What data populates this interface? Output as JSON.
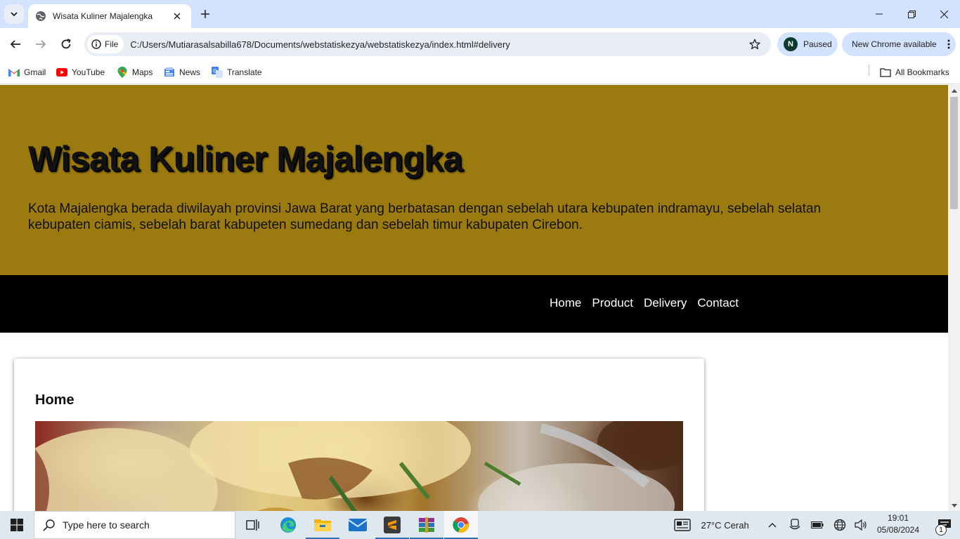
{
  "browser": {
    "tab": {
      "title": "Wisata Kuliner Majalengka"
    },
    "address": {
      "scheme_label": "File",
      "url": "C:/Users/Mutiarasalsabilla678/Documents/webstatiskezya/webstatiskezya/index.html#delivery"
    },
    "profile": {
      "initial": "N",
      "status": "Paused"
    },
    "update_label": "New Chrome available",
    "bookmarks": [
      {
        "label": "Gmail",
        "icon": "gmail-icon"
      },
      {
        "label": "YouTube",
        "icon": "youtube-icon"
      },
      {
        "label": "Maps",
        "icon": "maps-icon"
      },
      {
        "label": "News",
        "icon": "news-icon"
      },
      {
        "label": "Translate",
        "icon": "translate-icon"
      }
    ],
    "all_bookmarks_label": "All Bookmarks"
  },
  "page": {
    "header": {
      "title": "Wisata Kuliner Majalengka",
      "description": "Kota Majalengka berada diwilayah provinsi Jawa Barat yang berbatasan dengan sebelah utara kebupaten indramayu, sebelah selatan kebupaten ciamis, sebelah barat kabupeten sumedang dan sebelah timur kabupaten Cirebon."
    },
    "nav": [
      "Home",
      "Product",
      "Delivery",
      "Contact"
    ],
    "section": {
      "heading": "Home"
    },
    "colors": {
      "header_bg": "#9b7b0f",
      "nav_bg": "#000000"
    }
  },
  "taskbar": {
    "search_placeholder": "Type here to search",
    "weather": {
      "temp": "27°C",
      "condition": "Cerah"
    },
    "clock": {
      "time": "19:01",
      "date": "05/08/2024"
    },
    "notification_count": "1"
  }
}
